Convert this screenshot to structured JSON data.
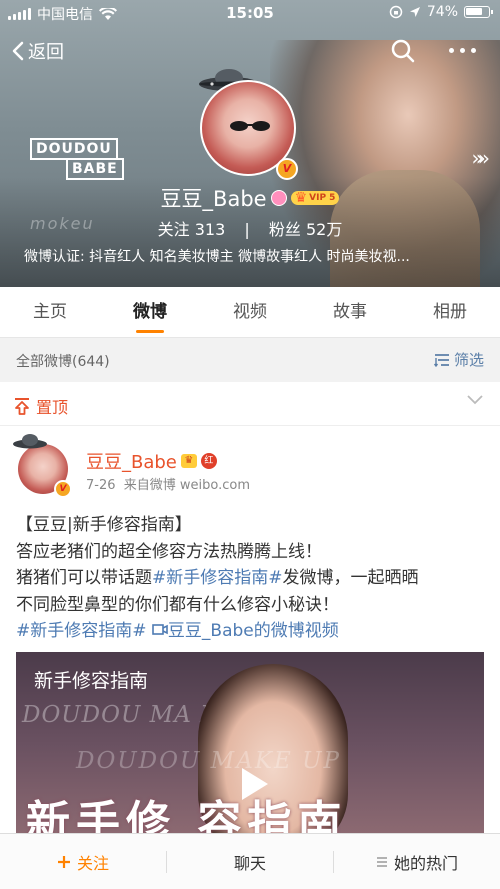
{
  "status_bar": {
    "carrier": "中国电信",
    "time": "15:05",
    "battery_text": "74%",
    "battery_level": 0.74
  },
  "nav": {
    "back_label": "返回"
  },
  "profile": {
    "logo_line1": "DOUDOU",
    "logo_line2": "BABE",
    "watermark": "mokeu",
    "name": "豆豆_Babe",
    "vip_label": "VIP 5",
    "verified_mark": "V",
    "following_label": "关注",
    "following_count": "313",
    "stats_separator": "|",
    "followers_label": "粉丝",
    "followers_count": "52万",
    "certification": "微博认证: 抖音红人 知名美妆博主 微博故事红人 时尚美妆视..."
  },
  "tabs": [
    "主页",
    "微博",
    "视频",
    "故事",
    "相册"
  ],
  "active_tab": "微博",
  "feed": {
    "all_label": "全部微博(644)",
    "filter_label": "筛选"
  },
  "pinned": {
    "label": "置顶"
  },
  "post": {
    "author": "豆豆_Babe",
    "crown_badge": "♛",
    "red_badge": "红",
    "date": "7-26",
    "source": "来自微博 weibo.com",
    "line1": "【豆豆|新手修容指南】",
    "line2": "答应老猪们的超全修容方法热腾腾上线！",
    "line3_a": "猪猪们可以带话题",
    "line3_hash": "#新手修容指南#",
    "line3_b": "发微博，一起晒晒",
    "line4": "不同脸型鼻型的你们都有什么修容小秘诀！",
    "hashtag": "#新手修容指南#",
    "video_link": "豆豆_Babe的微博视频",
    "video_title": "新手修容指南",
    "video_wm1": "DOUDOU MA          KE UP",
    "video_wm2": "DOUDOU           MAKE UP",
    "video_big": "新手修      容指南"
  },
  "bottom_bar": {
    "follow": "关注",
    "chat": "聊天",
    "hot": "她的热门"
  },
  "colors": {
    "accent": "#ff8200",
    "link": "#4e7bb3",
    "pinned": "#e8532c"
  }
}
